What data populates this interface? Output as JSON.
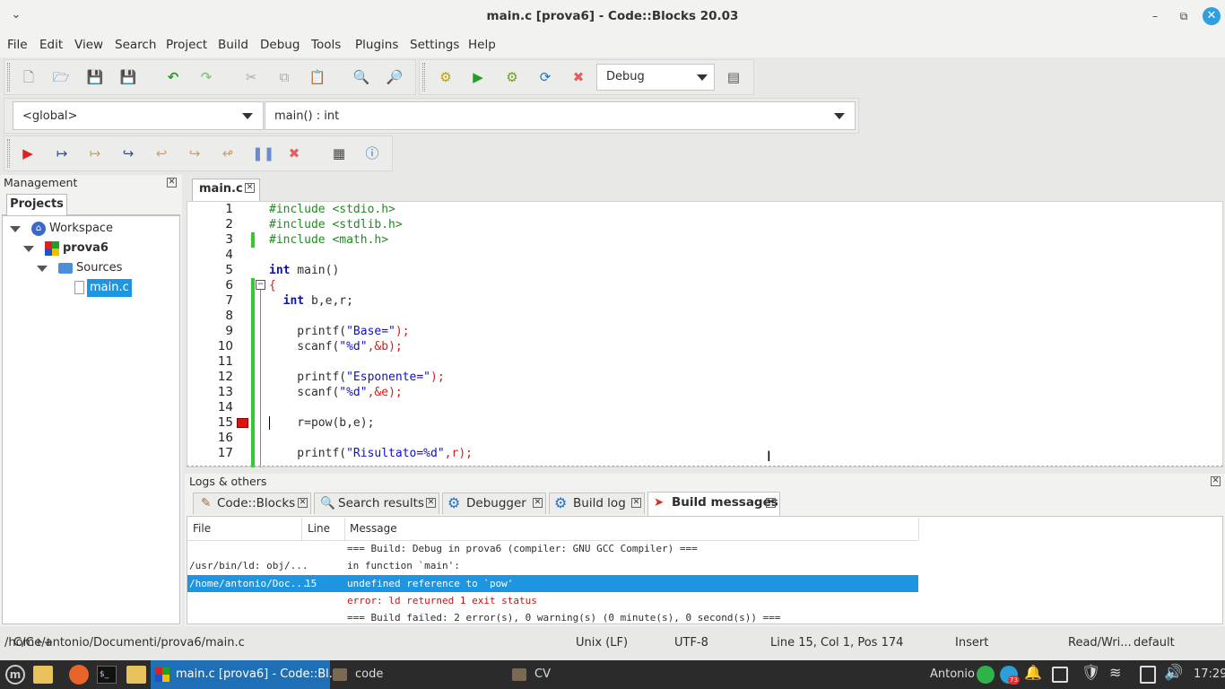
{
  "window": {
    "title": "main.c [prova6] - Code::Blocks 20.03"
  },
  "menubar": [
    "File",
    "Edit",
    "View",
    "Search",
    "Project",
    "Build",
    "Debug",
    "Tools",
    "Plugins",
    "Settings",
    "Help"
  ],
  "build_target": "Debug",
  "scope_combo": "<global>",
  "symbol_combo": "main() : int",
  "management": {
    "title": "Management",
    "tab": "Projects",
    "tree": {
      "workspace": "Workspace",
      "project": "prova6",
      "folder": "Sources",
      "file": "main.c"
    }
  },
  "editor": {
    "tab": "main.c",
    "line_numbers": [
      "1",
      "2",
      "3",
      "4",
      "5",
      "6",
      "7",
      "8",
      "9",
      "10",
      "11",
      "12",
      "13",
      "14",
      "15",
      "16",
      "17"
    ],
    "breakpoint_line": 15,
    "lines": [
      [
        {
          "t": "#include <stdio.h>",
          "c": "pp"
        }
      ],
      [
        {
          "t": "#include <stdlib.h>",
          "c": "pp"
        }
      ],
      [
        {
          "t": "#include <math.h>",
          "c": "pp"
        }
      ],
      [],
      [
        {
          "t": "int",
          "c": "kw"
        },
        {
          "t": " main()",
          "c": ""
        }
      ],
      [
        {
          "t": "{",
          "c": "op"
        }
      ],
      [
        {
          "t": "  ",
          "c": ""
        },
        {
          "t": "int",
          "c": "kw"
        },
        {
          "t": " b,e,r;",
          "c": ""
        }
      ],
      [],
      [
        {
          "t": "    printf(",
          "c": ""
        },
        {
          "t": "\"Base=\"",
          "c": "st"
        },
        {
          "t": ");",
          "c": "op"
        }
      ],
      [
        {
          "t": "    scanf(",
          "c": ""
        },
        {
          "t": "\"%d\"",
          "c": "st"
        },
        {
          "t": ",&b);",
          "c": "op"
        }
      ],
      [],
      [
        {
          "t": "    printf(",
          "c": ""
        },
        {
          "t": "\"Esponente=\"",
          "c": "st"
        },
        {
          "t": ");",
          "c": "op"
        }
      ],
      [
        {
          "t": "    scanf(",
          "c": ""
        },
        {
          "t": "\"%d\"",
          "c": "st"
        },
        {
          "t": ",&e);",
          "c": "op"
        }
      ],
      [],
      [
        {
          "t": "    r=pow(b,e);",
          "c": ""
        }
      ],
      [],
      [
        {
          "t": "    printf(",
          "c": ""
        },
        {
          "t": "\"Risultato=%d\"",
          "c": "st"
        },
        {
          "t": ",r);",
          "c": "op"
        }
      ]
    ]
  },
  "logs": {
    "title": "Logs & others",
    "tabs": [
      "Code::Blocks",
      "Search results",
      "Debugger",
      "Build log",
      "Build messages"
    ],
    "active_tab": "Build messages",
    "columns": [
      "File",
      "Line",
      "Message"
    ],
    "rows": [
      {
        "file": "",
        "line": "",
        "message": "=== Build: Debug in prova6 (compiler: GNU GCC Compiler) ===",
        "style": "normal"
      },
      {
        "file": "/usr/bin/ld: obj/...",
        "line": "",
        "message": "in function `main':",
        "style": "normal"
      },
      {
        "file": "/home/antonio/Doc...",
        "line": "15",
        "message": "undefined reference to `pow'",
        "style": "selected"
      },
      {
        "file": "",
        "line": "",
        "message": "error: ld returned 1 exit status",
        "style": "error"
      },
      {
        "file": "",
        "line": "",
        "message": "=== Build failed: 2 error(s), 0 warning(s) (0 minute(s), 0 second(s)) ===",
        "style": "normal"
      }
    ]
  },
  "statusbar": {
    "path": "/home/antonio/Documenti/prova6/main.c",
    "overlap": "C/C++",
    "eol": "Unix (LF)",
    "encoding": "UTF-8",
    "position": "Line 15, Col 1, Pos 174",
    "mode": "Insert",
    "access": "Read/Wri...",
    "profile": "default"
  },
  "taskbar": {
    "apps": [
      "main.c [prova6] - Code::Bl...",
      "code",
      "CV"
    ],
    "user": "Antonio",
    "badge": "73",
    "clock": "17:29"
  },
  "colors": {
    "accent": "#2f9fe0",
    "selection": "#1e95e0",
    "change_bar": "#34c834",
    "breakpoint": "#e01010",
    "taskbar": "#2b2b2b"
  }
}
